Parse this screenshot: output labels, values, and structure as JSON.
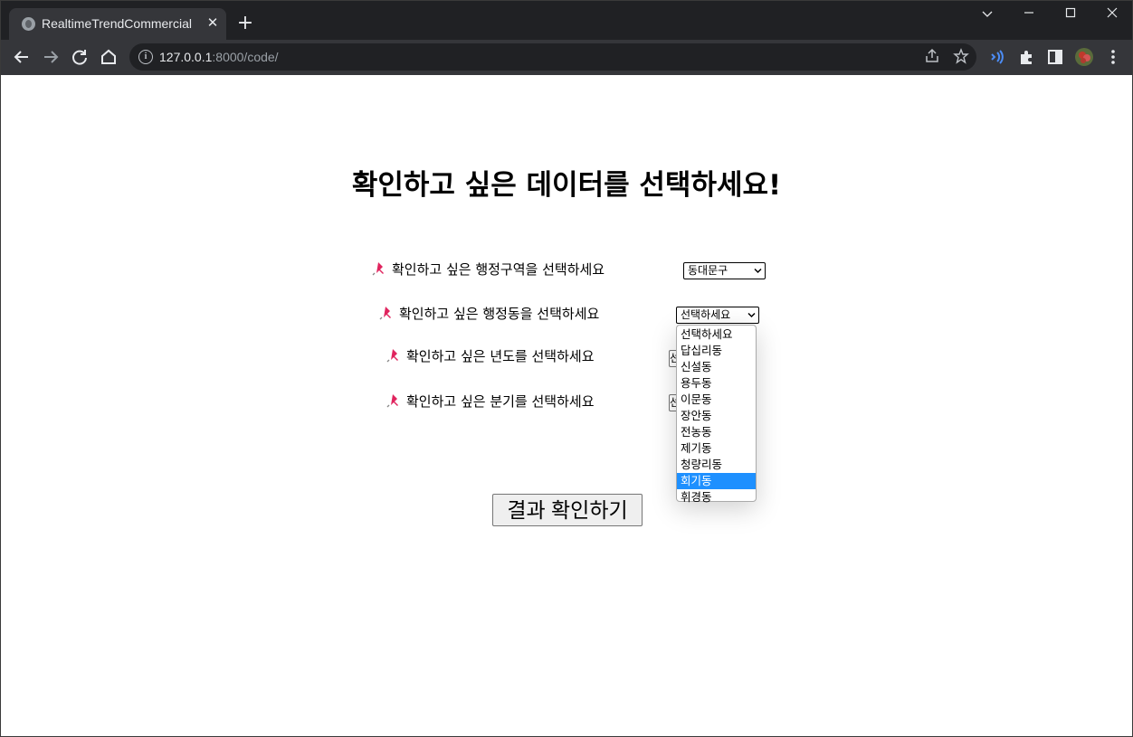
{
  "browser": {
    "tab_title": "RealtimeTrendCommercial",
    "url_host": "127.0.0.1",
    "url_rest": ":8000/code/"
  },
  "page": {
    "title": "확인하고 싶은 데이터를 선택하세요!",
    "rows": [
      {
        "label": "확인하고 싶은 행정구역을 선택하세요",
        "value": "동대문구"
      },
      {
        "label": "확인하고 싶은 행정동을 선택하세요",
        "value": "선택하세요"
      },
      {
        "label": "확인하고 싶은 년도를 선택하세요",
        "value": "선"
      },
      {
        "label": "확인하고 싶은 분기를 선택하세요",
        "value": "선"
      }
    ],
    "dong_options": [
      "선택하세요",
      "답십리동",
      "신설동",
      "용두동",
      "이문동",
      "장안동",
      "전농동",
      "제기동",
      "청량리동",
      "회기동",
      "휘경동"
    ],
    "highlighted_option": "회기동",
    "submit_label": "결과 확인하기"
  },
  "colors": {
    "titlebar": "#202124",
    "toolbar": "#35363a",
    "highlight": "#1e90ff",
    "pin": "#e0245e"
  },
  "icons": [
    "globe-icon",
    "close-icon",
    "plus-icon",
    "chevron-down-icon",
    "minimize-icon",
    "maximize-icon",
    "back-icon",
    "forward-icon",
    "reload-icon",
    "home-icon",
    "info-icon",
    "share-icon",
    "star-icon",
    "sound-icon",
    "extensions-icon",
    "side-panel-icon",
    "profile-avatar",
    "menu-icon",
    "pin-icon"
  ]
}
